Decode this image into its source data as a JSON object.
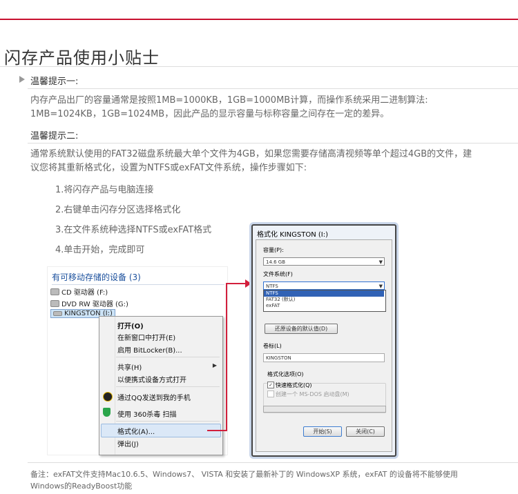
{
  "page": {
    "title": "闪存产品使用小贴士",
    "tip1_heading": "温馨提示一:",
    "tip1_line1": "内存产品出厂的容量通常是按照1MB=1000KB，1GB=1000MB计算，而操作系统采用二进制算法:",
    "tip1_line2": "1MB=1024KB，1GB=1024MB，因此产品的显示容量与标称容量之间存在一定的差异。",
    "tip2_heading": "温馨提示二:",
    "tip2_line1": "通常系统默认使用的FAT32磁盘系统最大单个文件为4GB，如果您需要存储高清视频等单个超过4GB的文件，建",
    "tip2_line2": "议您将其重新格式化，设置为NTFS或exFAT文件系统，操作步骤如下:",
    "steps": [
      "1.将闪存产品与电脑连接",
      "2.右键单击闪存分区选择格式化",
      "3.在文件系统种选择NTFS或exFAT格式",
      "4.单击开始，完成即可"
    ],
    "note_line1": "备注：exFAT文件支持Mac10.6.5、Windows7、  VISTA  和安装了最新补丁的 WindowsXP 系统，exFAT 的设备将不能够使用",
    "note_line2": "Windows的ReadyBoost功能"
  },
  "explorer": {
    "heading": "有可移动存储的设备 (3)",
    "drives": [
      {
        "label": "CD 驱动器 (F:)",
        "icon": "cd-drive-icon"
      },
      {
        "label": "DVD RW 驱动器 (G:)",
        "icon": "dvd-drive-icon"
      },
      {
        "label": "KINGSTON (I:)",
        "icon": "usb-drive-icon"
      }
    ]
  },
  "context_menu": {
    "items": [
      {
        "label": "打开(O)"
      },
      {
        "label": "在新窗口中打开(E)"
      },
      {
        "label": "启用 BitLocker(B)..."
      },
      {
        "label": "共享(H)"
      },
      {
        "label": "以便携式设备方式打开"
      },
      {
        "label": "通过QQ发送到我的手机"
      },
      {
        "label": "使用 360杀毒 扫描"
      },
      {
        "label": "格式化(A)..."
      },
      {
        "label": "弹出(J)"
      }
    ]
  },
  "format_dialog": {
    "title": "格式化 KINGSTON (I:)",
    "capacity_label": "容量(P):",
    "capacity_value": "14.6 GB",
    "fs_label": "文件系统(F)",
    "fs_value": "NTFS",
    "fs_options": [
      "NTFS",
      "FAT32 (默认)",
      "exFAT"
    ],
    "restore_button": "还原设备的默认值(D)",
    "volume_label": "卷标(L)",
    "volume_value": "KINGSTON",
    "options_label": "格式化选项(O)",
    "quick_format": "快速格式化(Q)",
    "create_msdos": "创建一个 MS-DOS 启动盘(M)",
    "start_button": "开始(S)",
    "close_button": "关闭(C)"
  },
  "colors": {
    "accent_red": "#c8102e",
    "link_blue": "#1a4f9c",
    "selection_blue": "#3162b5"
  }
}
